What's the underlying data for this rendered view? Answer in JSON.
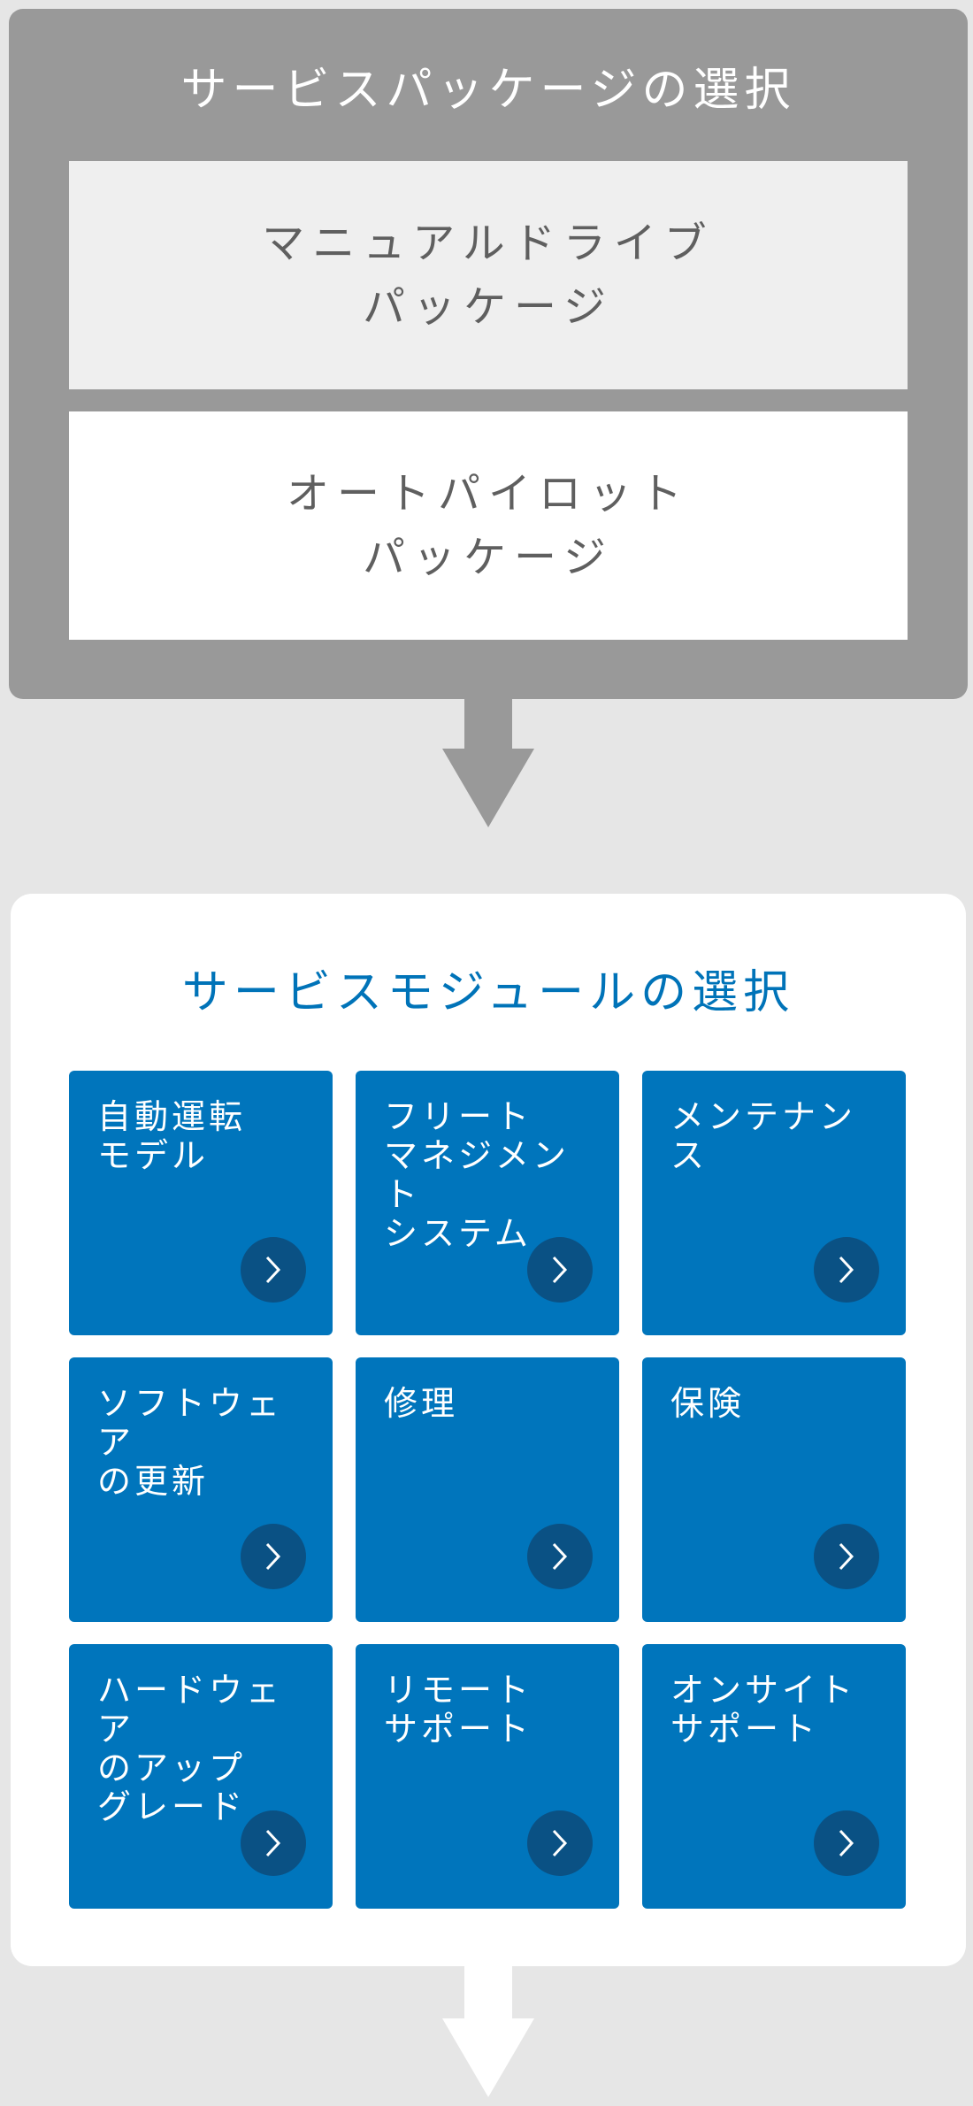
{
  "package_section": {
    "title": "サービスパッケージの選択",
    "options": [
      {
        "id": "manual",
        "label": "マニュアルドライブ\nパッケージ"
      },
      {
        "id": "autopilot",
        "label": "オートパイロット\nパッケージ"
      }
    ]
  },
  "module_section": {
    "title": "サービスモジュールの選択",
    "modules": [
      {
        "label": "自動運転\nモデル"
      },
      {
        "label": "フリート\nマネジメント\nシステム"
      },
      {
        "label": "メンテナンス"
      },
      {
        "label": "ソフトウェア\nの更新"
      },
      {
        "label": "修理"
      },
      {
        "label": "保険"
      },
      {
        "label": "ハードウェア\nのアップ\nグレード"
      },
      {
        "label": "リモート\nサポート"
      },
      {
        "label": "オンサイト\nサポート"
      }
    ]
  },
  "colors": {
    "page_background": "#e6e6e6",
    "package_panel": "#999999",
    "module_title": "#0073b8",
    "module_card": "#0075bc",
    "module_button": "#0a5184"
  },
  "icons": {
    "module_button": "chevron-right-icon",
    "flow": "arrow-down-icon"
  }
}
